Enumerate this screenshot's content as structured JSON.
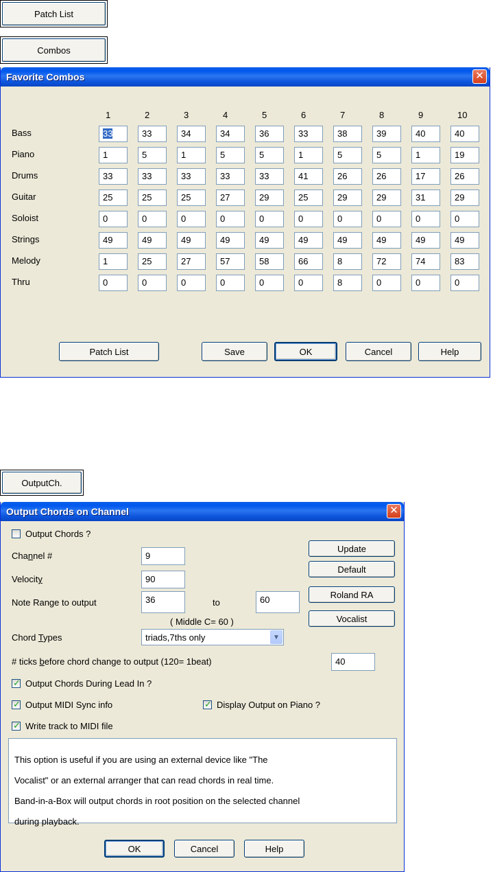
{
  "top_buttons": {
    "patch_list": "Patch List",
    "combos": "Combos",
    "output_ch": "OutputCh."
  },
  "combos_dialog": {
    "title": "Favorite Combos",
    "close": "✕",
    "columns": [
      "1",
      "2",
      "3",
      "4",
      "5",
      "6",
      "7",
      "8",
      "9",
      "10"
    ],
    "rows": [
      {
        "label": "Bass",
        "values": [
          "33",
          "33",
          "34",
          "34",
          "36",
          "33",
          "38",
          "39",
          "40",
          "40"
        ]
      },
      {
        "label": "Piano",
        "values": [
          "1",
          "5",
          "1",
          "5",
          "5",
          "1",
          "5",
          "5",
          "1",
          "19"
        ]
      },
      {
        "label": "Drums",
        "values": [
          "33",
          "33",
          "33",
          "33",
          "33",
          "41",
          "26",
          "26",
          "17",
          "26"
        ]
      },
      {
        "label": "Guitar",
        "values": [
          "25",
          "25",
          "25",
          "27",
          "29",
          "25",
          "29",
          "29",
          "31",
          "29"
        ]
      },
      {
        "label": "Soloist",
        "values": [
          "0",
          "0",
          "0",
          "0",
          "0",
          "0",
          "0",
          "0",
          "0",
          "0"
        ]
      },
      {
        "label": "Strings",
        "values": [
          "49",
          "49",
          "49",
          "49",
          "49",
          "49",
          "49",
          "49",
          "49",
          "49"
        ]
      },
      {
        "label": "Melody",
        "values": [
          "1",
          "25",
          "27",
          "57",
          "58",
          "66",
          "8",
          "72",
          "74",
          "83"
        ]
      },
      {
        "label": "Thru",
        "values": [
          "0",
          "0",
          "0",
          "0",
          "0",
          "0",
          "8",
          "0",
          "0",
          "0"
        ]
      }
    ],
    "buttons": {
      "patch_list": "Patch List",
      "save": "Save",
      "ok": "OK",
      "cancel": "Cancel",
      "help": "Help"
    }
  },
  "output_dialog": {
    "title": "Output Chords on Channel",
    "close": "✕",
    "output_chords": {
      "label": "Output Chords ?",
      "checked": false
    },
    "channel": {
      "label_pre": "Cha",
      "label_u": "n",
      "label_post": "nel #",
      "value": "9"
    },
    "velocity": {
      "label_pre": "Velocit",
      "label_u": "y",
      "label_post": "",
      "value": "90"
    },
    "note_range": {
      "label": "Note Range to output",
      "from": "36",
      "to_label": "to",
      "to": "60"
    },
    "middle_c": "( Middle C= 60 )",
    "chord_types": {
      "label_pre": "Chord ",
      "label_u": "T",
      "label_post": "ypes",
      "value": "triads,7ths only"
    },
    "ticks": {
      "label_pre": "# ticks ",
      "label_u": "b",
      "label_post": "efore chord change to output (120= 1beat)",
      "value": "40"
    },
    "during_lead_in": {
      "label": "Output Chords During Lead In ?",
      "checked": true
    },
    "midi_sync": {
      "label": "Output MIDI Sync info",
      "checked": true
    },
    "display_piano": {
      "label": "Display Output on Piano ?",
      "checked": true
    },
    "write_track": {
      "label": "Write track to MIDI file",
      "checked": true
    },
    "description": "This option is useful if you are using an external device like \"The Vocalist\" or an external arranger that can read chords in real time.\nBand-in-a-Box will output chords in root position on the selected channel during playback.",
    "description_lines": [
      "This option is useful if you are using an external device like \"The",
      "Vocalist\" or an external arranger that can read chords in real time.",
      "Band-in-a-Box will output chords in root position on the selected channel",
      "during playback."
    ],
    "side_buttons": {
      "update": "Update",
      "default": "Default",
      "roland": "Roland RA",
      "vocalist": "Vocalist"
    },
    "buttons": {
      "ok": "OK",
      "cancel": "Cancel",
      "help": "Help"
    }
  }
}
